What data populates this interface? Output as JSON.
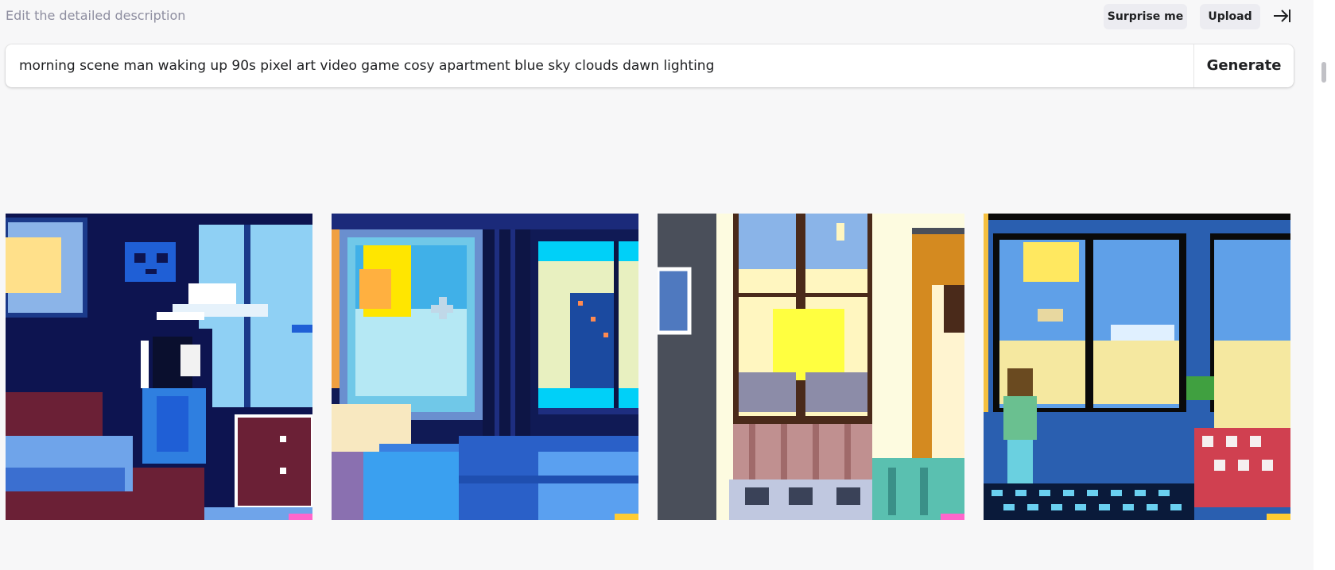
{
  "header": {
    "hint": "Edit the detailed description",
    "surprise_label": "Surprise me",
    "upload_label": "Upload",
    "collapse_icon": "arrow-to-right-bar-icon"
  },
  "prompt": {
    "value": "morning scene man waking up 90s pixel art video game cosy apartment blue sky clouds dawn lighting",
    "generate_label": "Generate"
  },
  "images": [
    {
      "subject": "pixel art bedroom, man by window, blue sky"
    },
    {
      "subject": "pixel art bedroom, window with sun and bird, city view"
    },
    {
      "subject": "pixel art apartment window at dawn with sun and moon"
    },
    {
      "subject": "pixel art room, boy looking out large window"
    }
  ],
  "colors": {
    "background": "#f7f7f8",
    "pill": "#ececf1",
    "text": "#202123",
    "hint": "#8e8ea0"
  }
}
